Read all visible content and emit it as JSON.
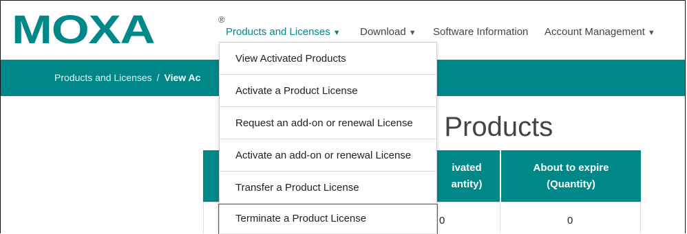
{
  "brand": {
    "logo_text": "MOXA",
    "registered_mark": "®",
    "color": "#008787"
  },
  "nav": {
    "items": [
      {
        "label": "Products and Licenses",
        "caret": "▼"
      },
      {
        "label": "Download",
        "caret": "▼"
      },
      {
        "label": "Software Information"
      },
      {
        "label": "Account Management",
        "caret": "▼"
      }
    ]
  },
  "breadcrumb": {
    "parent": "Products and Licenses",
    "separator": "/",
    "current": "View Ac"
  },
  "page": {
    "title_visible": "d Products"
  },
  "table": {
    "headers": [
      {
        "line1": "ivated",
        "line2": "antity)"
      },
      {
        "line1": "About to expire",
        "line2": "(Quantity)"
      }
    ],
    "row": {
      "activated": "0",
      "expire": "0"
    }
  },
  "dropdown": {
    "items": [
      {
        "label": "View Activated Products"
      },
      {
        "label": "Activate a Product License"
      },
      {
        "label": "Request an add-on or renewal License"
      },
      {
        "label": "Activate an add-on or renewal License"
      },
      {
        "label": "Transfer a Product License"
      },
      {
        "label": "Terminate a Product License"
      }
    ]
  }
}
